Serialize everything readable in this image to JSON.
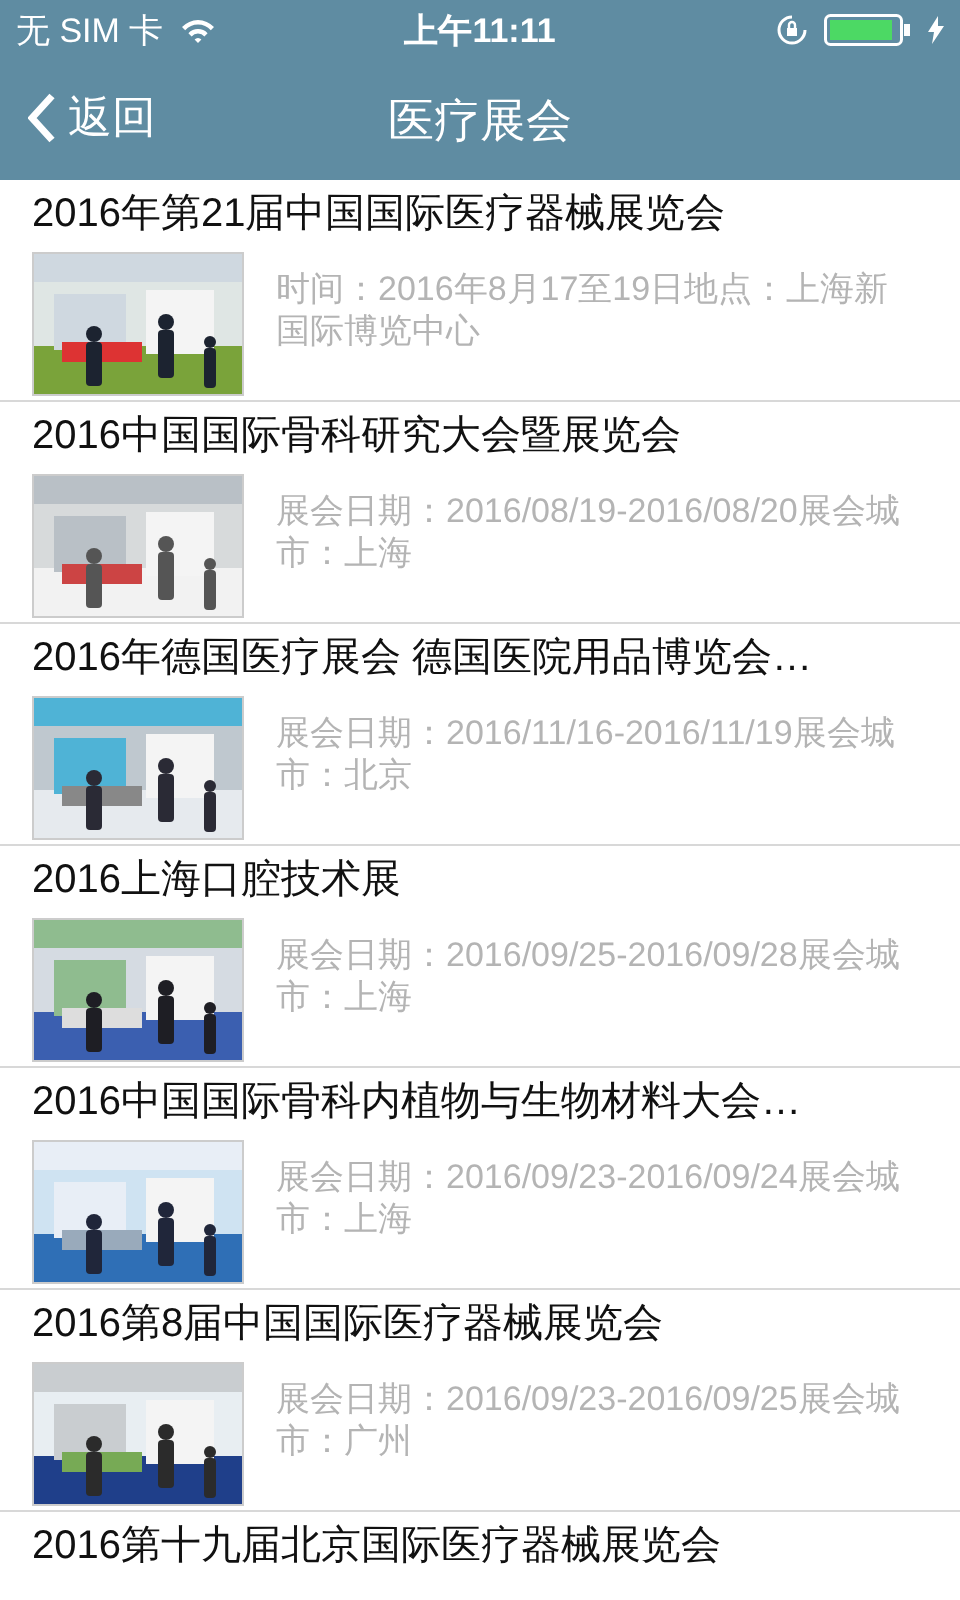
{
  "status_bar": {
    "carrier": "无 SIM 卡",
    "time": "上午11:11"
  },
  "nav_bar": {
    "back_label": "返回",
    "title": "医疗展会"
  },
  "exhibitions": [
    {
      "title": "2016年第21届中国国际医疗器械展览会",
      "description": "时间：2016年8月17至19日地点：上海新国际博览中心"
    },
    {
      "title": "2016中国国际骨科研究大会暨展览会",
      "description": "展会日期：2016/08/19-2016/08/20展会城市：上海"
    },
    {
      "title": "2016年德国医疗展会 德国医院用品博览会…",
      "description": "展会日期：2016/11/16-2016/11/19展会城市：北京"
    },
    {
      "title": "2016上海口腔技术展",
      "description": "展会日期：2016/09/25-2016/09/28展会城市：上海"
    },
    {
      "title": "2016中国国际骨科内植物与生物材料大会…",
      "description": "展会日期：2016/09/23-2016/09/24展会城市：上海"
    },
    {
      "title": "2016第8届中国国际医疗器械展览会",
      "description": "展会日期：2016/09/23-2016/09/25展会城市：广州"
    },
    {
      "title": "2016第十九届北京国际医疗器械展览会"
    }
  ]
}
